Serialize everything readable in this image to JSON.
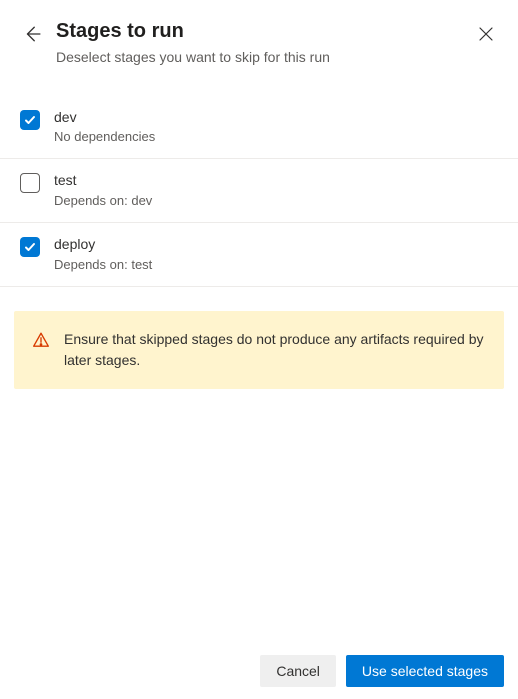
{
  "header": {
    "title": "Stages to run",
    "subtitle": "Deselect stages you want to skip for this run"
  },
  "stages": [
    {
      "name": "dev",
      "deps": "No dependencies",
      "checked": true
    },
    {
      "name": "test",
      "deps": "Depends on: dev",
      "checked": false
    },
    {
      "name": "deploy",
      "deps": "Depends on: test",
      "checked": true
    }
  ],
  "warning": {
    "text": "Ensure that skipped stages do not produce any artifacts required by later stages."
  },
  "footer": {
    "cancel_label": "Cancel",
    "confirm_label": "Use selected stages"
  },
  "colors": {
    "primary": "#0078d4",
    "warning_bg": "#fff4ce",
    "warning_icon": "#d83b01"
  }
}
